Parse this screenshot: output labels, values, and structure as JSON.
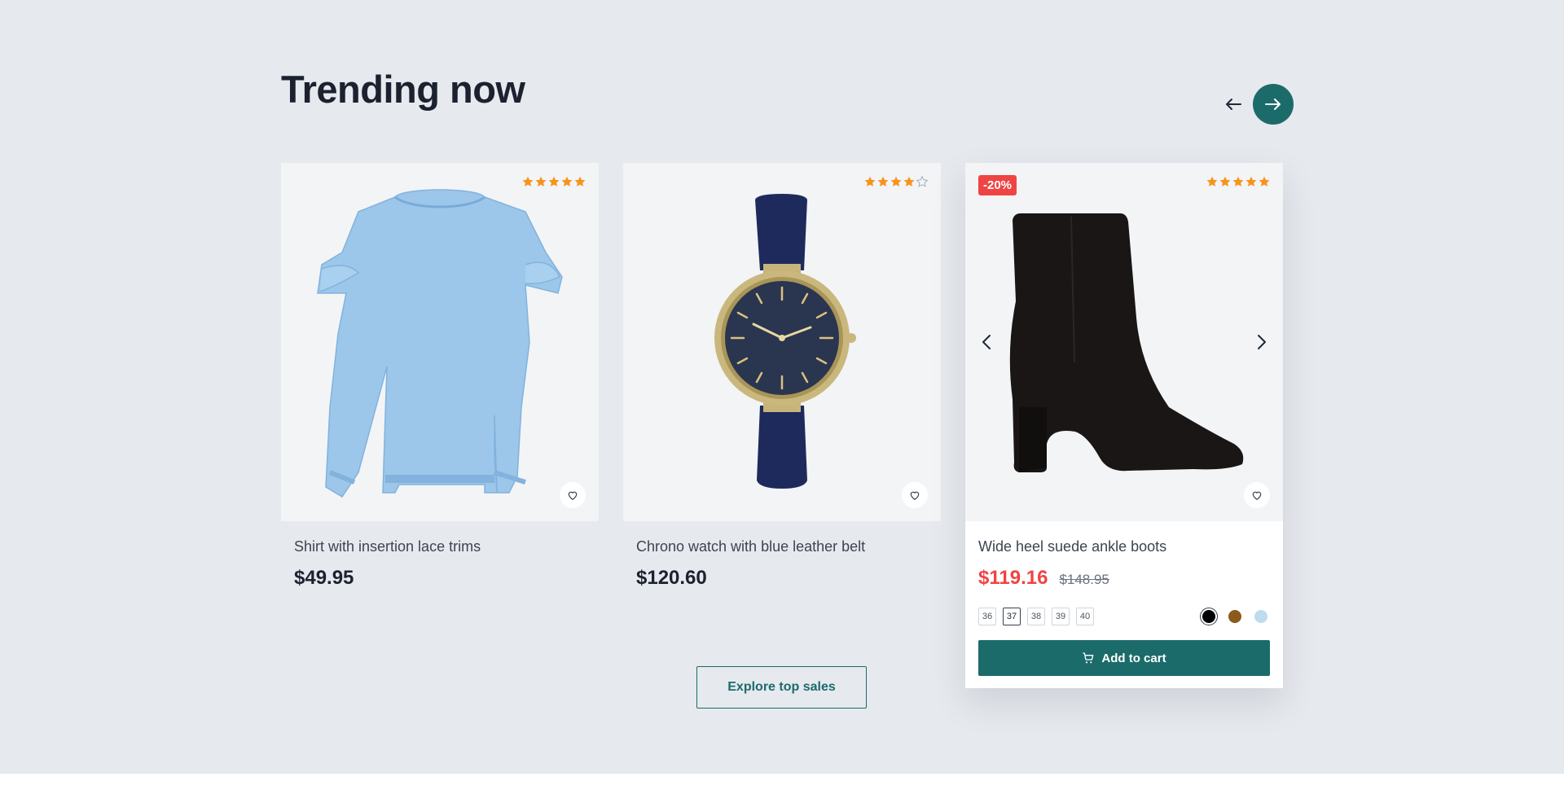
{
  "section": {
    "title": "Trending now",
    "nav": {
      "prev_icon": "arrow-left-icon",
      "next_icon": "arrow-right-icon"
    }
  },
  "colors": {
    "accent": "#1c6b6b",
    "sale": "#ef4444",
    "star": "#f7941d",
    "background": "#e6e9ee"
  },
  "products": [
    {
      "name": "Shirt with insertion lace trims",
      "price": "$49.95",
      "rating": 5
    },
    {
      "name": "Chrono watch with blue leather belt",
      "price": "$120.60",
      "rating": 4
    },
    {
      "name": "Wide heel suede ankle boots",
      "price": "$119.16",
      "old_price": "$148.95",
      "badge": "-20%",
      "rating": 5,
      "sizes": [
        "36",
        "37",
        "38",
        "39",
        "40"
      ],
      "selected_size": "37",
      "swatches": [
        "#000000",
        "#8b5a1c",
        "#bfdbee"
      ],
      "selected_swatch": "#000000",
      "add_to_cart_label": "Add to cart"
    }
  ],
  "explore_label": "Explore top sales"
}
